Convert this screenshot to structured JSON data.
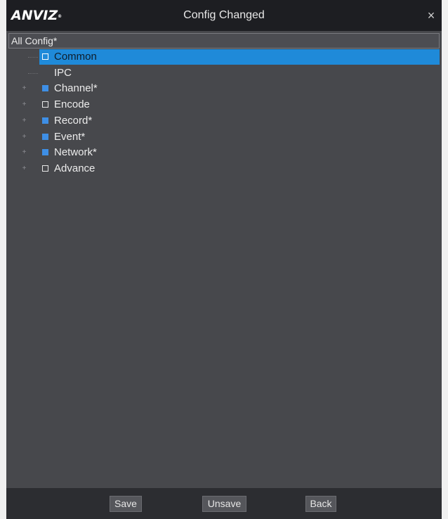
{
  "window": {
    "logo_text": "ANVIZ",
    "logo_mark": "®",
    "title": "Config Changed",
    "close_symbol": "×"
  },
  "tree": {
    "root_label": "All Config*",
    "items": [
      {
        "label": "Common",
        "checkbox": "empty",
        "expander": false,
        "selected": true
      },
      {
        "label": "IPC",
        "checkbox": "none",
        "expander": false,
        "selected": false
      },
      {
        "label": "Channel*",
        "checkbox": "filled",
        "expander": true,
        "selected": false
      },
      {
        "label": "Encode",
        "checkbox": "empty",
        "expander": true,
        "selected": false
      },
      {
        "label": "Record*",
        "checkbox": "filled",
        "expander": true,
        "selected": false
      },
      {
        "label": "Event*",
        "checkbox": "filled",
        "expander": true,
        "selected": false
      },
      {
        "label": "Network*",
        "checkbox": "filled",
        "expander": true,
        "selected": false
      },
      {
        "label": "Advance",
        "checkbox": "empty",
        "expander": true,
        "selected": false
      }
    ],
    "expander_symbol": "+"
  },
  "footer": {
    "save_label": "Save",
    "unsave_label": "Unsave",
    "back_label": "Back"
  },
  "colors": {
    "selection": "#1f8ad9",
    "checkbox_filled": "#3e8fe6",
    "panel_bg": "#47484c",
    "titlebar_bg": "#1d1e22"
  }
}
